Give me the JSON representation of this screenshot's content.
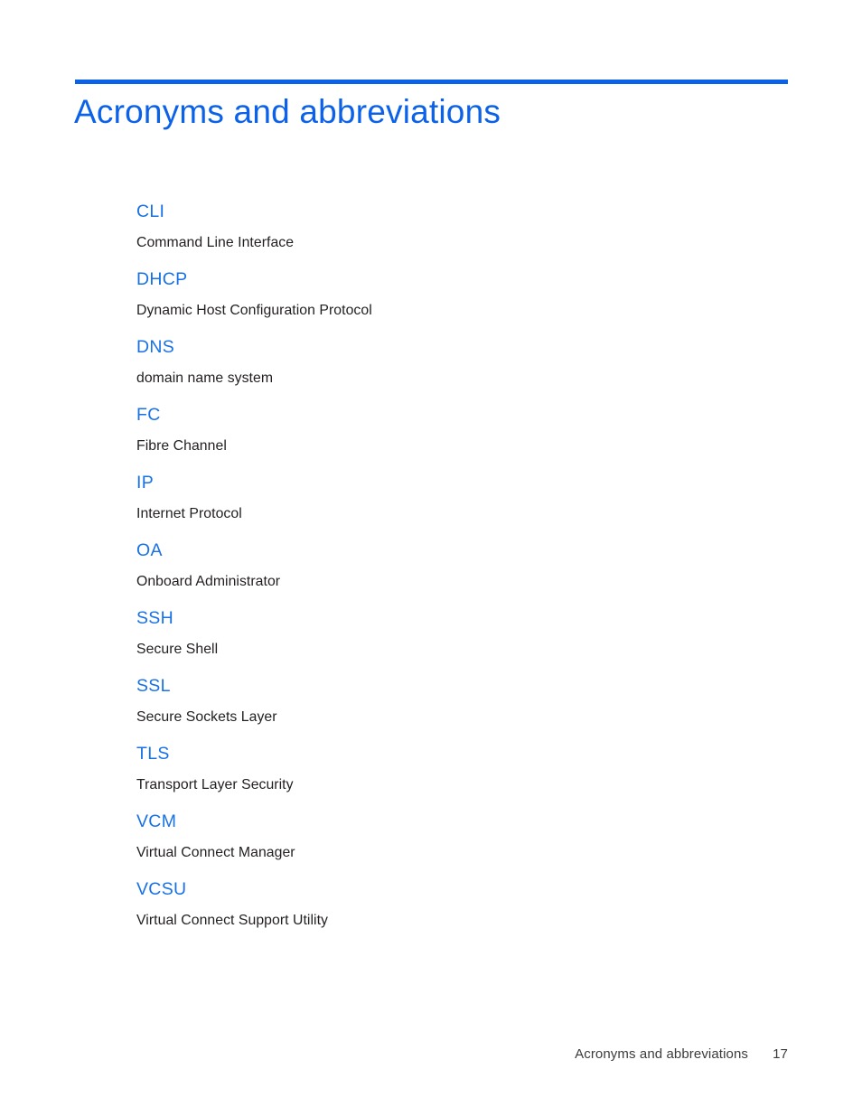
{
  "document": {
    "page_background": "#FFFFFF",
    "accent_color": "#0B62E8",
    "term_color": "#1872E6",
    "body_color": "#231F20"
  },
  "header": {
    "title": "Acronyms and abbreviations"
  },
  "glossary": {
    "entries": [
      {
        "term": "CLI",
        "definition": "Command Line Interface"
      },
      {
        "term": "DHCP",
        "definition": "Dynamic Host Configuration Protocol"
      },
      {
        "term": "DNS",
        "definition": "domain name system"
      },
      {
        "term": "FC",
        "definition": "Fibre Channel"
      },
      {
        "term": "IP",
        "definition": "Internet Protocol"
      },
      {
        "term": "OA",
        "definition": "Onboard Administrator"
      },
      {
        "term": "SSH",
        "definition": "Secure Shell"
      },
      {
        "term": "SSL",
        "definition": "Secure Sockets Layer"
      },
      {
        "term": "TLS",
        "definition": "Transport Layer Security"
      },
      {
        "term": "VCM",
        "definition": "Virtual Connect Manager"
      },
      {
        "term": "VCSU",
        "definition": "Virtual Connect Support Utility"
      }
    ]
  },
  "footer": {
    "section_title": "Acronyms and abbreviations",
    "page_number": "17"
  }
}
